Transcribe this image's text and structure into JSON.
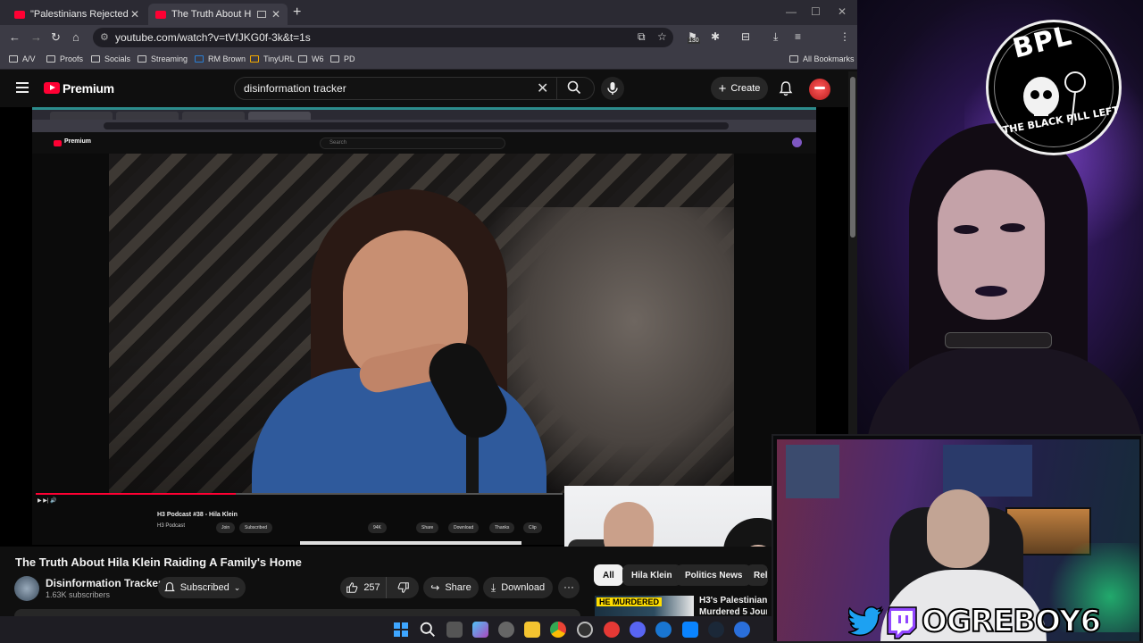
{
  "browser": {
    "tabs": [
      {
        "title": "\"Palestinians Rejected Every",
        "active": false
      },
      {
        "title": "The Truth About Hila Klein",
        "active": true
      }
    ],
    "address": "youtube.com/watch?v=tVfJKG0f-3k&t=1s",
    "extension_badge": "130",
    "bookmarks": [
      "A/V",
      "Proofs",
      "Socials",
      "Streaming",
      "RM Brown",
      "TinyURL",
      "W6",
      "PD"
    ],
    "all_bookmarks": "All Bookmarks"
  },
  "youtube": {
    "brand": "Premium",
    "search_query": "disinformation tracker",
    "create_label": "Create"
  },
  "embedded": {
    "brand": "Premium",
    "search_placeholder": "Search",
    "title": "H3 Podcast #38 - Hila Klein",
    "channel": "H3 Podcast",
    "join": "Join",
    "subscribed": "Subscribed",
    "likes": "94K",
    "share": "Share",
    "download": "Download",
    "thanks": "Thanks",
    "clip": "Clip"
  },
  "video": {
    "title": "The Truth About Hila Klein Raiding A Family's Home",
    "channel": "Disinformation Tracker",
    "subscribers": "1.63K subscribers",
    "subscribe_state": "Subscribed",
    "likes": "257",
    "share": "Share",
    "download": "Download",
    "more": "···"
  },
  "chips": [
    "All",
    "Hila Klein",
    "Politics News",
    "Rel"
  ],
  "recommended": {
    "thumb_tag": "HE MURDERED",
    "title_line1": "H3's Palestinian T",
    "title_line2": "Murdered 5 Journ"
  },
  "overlay": {
    "badge_title": "BPL",
    "badge_subtitle": "THE BLACK PILL LEFT",
    "handle": "OGREBOY6"
  },
  "colors": {
    "yt_red": "#ff0033",
    "overlay_purple": "#4a2a80"
  }
}
